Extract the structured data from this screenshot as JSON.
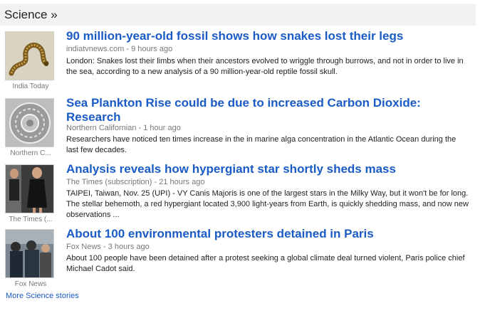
{
  "section": {
    "title": "Science »"
  },
  "stories": [
    {
      "headline": "90 million-year-old fossil shows how snakes lost their legs",
      "source": "indiatvnews.com",
      "time": "9 hours ago",
      "snippet": "London: Snakes lost their limbs when their ancestors evolved to wriggle through burrows, and not in order to live in the sea, according to a new analysis of a 90 million-year-old reptile fossil skull.",
      "image_source": "India Today",
      "image_icon": "snake-fossil-image"
    },
    {
      "headline": "Sea Plankton Rise could be due to increased Carbon Dioxide: Research",
      "source": "Northern Californian",
      "time": "1 hour ago",
      "snippet": "Researchers have noticed ten times increase in the in marine alga concentration in the Atlantic Ocean during the last few decades.",
      "image_source": "Northern C...",
      "image_icon": "plankton-image"
    },
    {
      "headline": "Analysis reveals how hypergiant star shortly sheds mass",
      "source": "The Times (subscription)",
      "time": "21 hours ago",
      "snippet": "TAIPEI, Taiwan, Nov. 25 (UPI) - VY Canis Majoris is one of the largest stars in the Milky Way, but it won't be for long. The stellar behemoth, a red hypergiant located 3,900 light-years from Earth, is quickly shedding mass, and now new observations ...",
      "image_source": "The Times (...",
      "image_icon": "fashion-photo-image"
    },
    {
      "headline": "About 100 environmental protesters detained in Paris",
      "source": "Fox News",
      "time": "3 hours ago",
      "snippet": "About 100 people have been detained after a protest seeking a global climate deal turned violent, Paris police chief Michael Cadot said.",
      "image_source": "Fox News",
      "image_icon": "protest-photo-image"
    }
  ],
  "meta_separator": " - ",
  "more_link": "More Science stories",
  "colors": {
    "link": "#1a5bc6",
    "meta": "#777777",
    "header_bg": "#f2f2f2"
  }
}
